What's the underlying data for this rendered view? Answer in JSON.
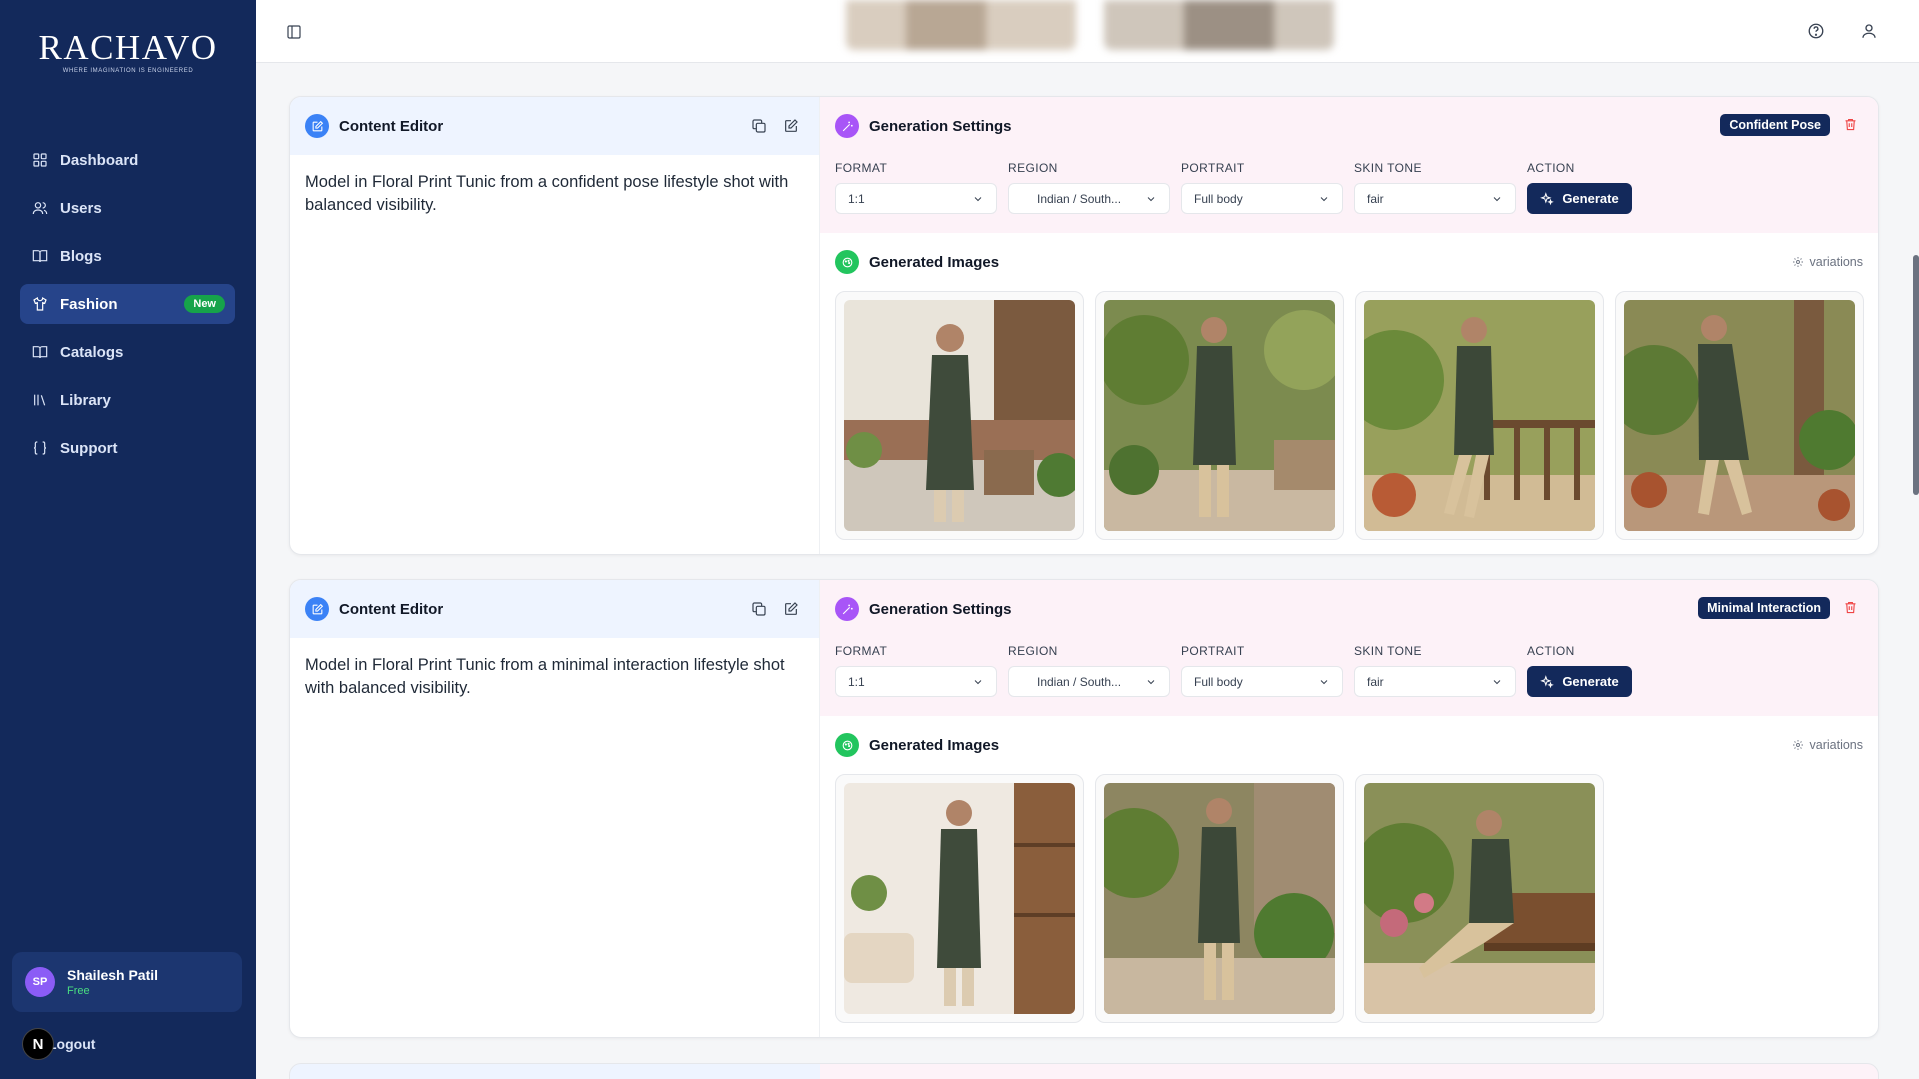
{
  "brand": {
    "name": "RACHAVO",
    "tagline": "WHERE IMAGINATION IS ENGINEERED"
  },
  "sidebar": {
    "items": [
      {
        "label": "Dashboard",
        "icon": "grid-icon"
      },
      {
        "label": "Users",
        "icon": "users-icon"
      },
      {
        "label": "Blogs",
        "icon": "book-open-icon"
      },
      {
        "label": "Fashion",
        "icon": "shirt-icon",
        "active": true,
        "badge": "New"
      },
      {
        "label": "Catalogs",
        "icon": "book-open-icon"
      },
      {
        "label": "Library",
        "icon": "library-icon"
      },
      {
        "label": "Support",
        "icon": "braces-icon"
      }
    ],
    "user": {
      "initials": "SP",
      "name": "Shailesh Patil",
      "plan": "Free"
    },
    "logout_label": "Logout",
    "n_badge": "N"
  },
  "cards": [
    {
      "editor_title": "Content Editor",
      "editor_text": "Model in Floral Print Tunic from a confident pose lifestyle shot with balanced visibility.",
      "settings_title": "Generation Settings",
      "badge": "Confident Pose",
      "fields": {
        "format_label": "FORMAT",
        "format_value": "1:1",
        "region_label": "REGION",
        "region_value": "Indian / South...",
        "portrait_label": "PORTRAIT",
        "portrait_value": "Full body",
        "skin_label": "SKIN TONE",
        "skin_value": "fair",
        "action_label": "ACTION",
        "action_button": "Generate"
      },
      "images_title": "Generated Images",
      "variations_label": "variations",
      "image_count": 4
    },
    {
      "editor_title": "Content Editor",
      "editor_text": "Model in Floral Print Tunic from a minimal interaction lifestyle shot with balanced visibility.",
      "settings_title": "Generation Settings",
      "badge": "Minimal Interaction",
      "fields": {
        "format_label": "FORMAT",
        "format_value": "1:1",
        "region_label": "REGION",
        "region_value": "Indian / South...",
        "portrait_label": "PORTRAIT",
        "portrait_value": "Full body",
        "skin_label": "SKIN TONE",
        "skin_value": "fair",
        "action_label": "ACTION",
        "action_button": "Generate"
      },
      "images_title": "Generated Images",
      "variations_label": "variations",
      "image_count": 3
    }
  ],
  "colors": {
    "sidebar_bg": "#13295b",
    "accent_navy": "#13295b",
    "new_badge": "#16a34a",
    "delete": "#ef4444",
    "editor_icon": "#3b82f6",
    "settings_icon": "#a855f7",
    "images_icon": "#22c55e"
  }
}
